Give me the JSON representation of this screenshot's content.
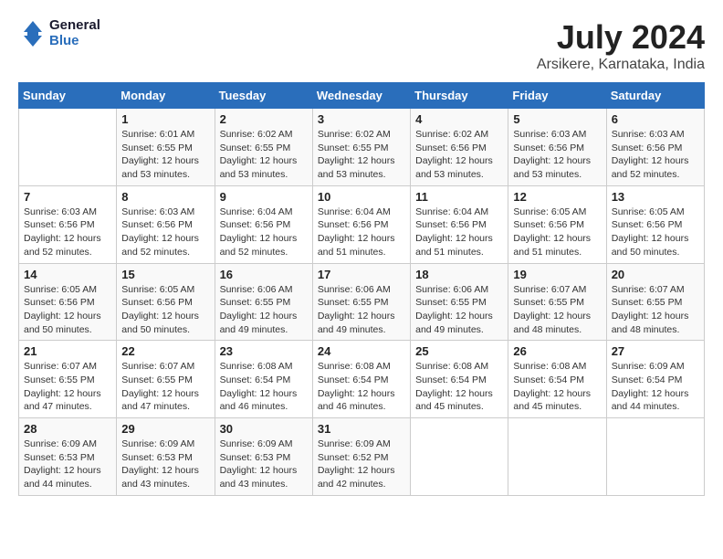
{
  "logo": {
    "text_general": "General",
    "text_blue": "Blue"
  },
  "header": {
    "month_year": "July 2024",
    "location": "Arsikere, Karnataka, India"
  },
  "days_of_week": [
    "Sunday",
    "Monday",
    "Tuesday",
    "Wednesday",
    "Thursday",
    "Friday",
    "Saturday"
  ],
  "weeks": [
    [
      {
        "day": "",
        "content": ""
      },
      {
        "day": "1",
        "content": "Sunrise: 6:01 AM\nSunset: 6:55 PM\nDaylight: 12 hours\nand 53 minutes."
      },
      {
        "day": "2",
        "content": "Sunrise: 6:02 AM\nSunset: 6:55 PM\nDaylight: 12 hours\nand 53 minutes."
      },
      {
        "day": "3",
        "content": "Sunrise: 6:02 AM\nSunset: 6:55 PM\nDaylight: 12 hours\nand 53 minutes."
      },
      {
        "day": "4",
        "content": "Sunrise: 6:02 AM\nSunset: 6:56 PM\nDaylight: 12 hours\nand 53 minutes."
      },
      {
        "day": "5",
        "content": "Sunrise: 6:03 AM\nSunset: 6:56 PM\nDaylight: 12 hours\nand 53 minutes."
      },
      {
        "day": "6",
        "content": "Sunrise: 6:03 AM\nSunset: 6:56 PM\nDaylight: 12 hours\nand 52 minutes."
      }
    ],
    [
      {
        "day": "7",
        "content": "Sunrise: 6:03 AM\nSunset: 6:56 PM\nDaylight: 12 hours\nand 52 minutes."
      },
      {
        "day": "8",
        "content": "Sunrise: 6:03 AM\nSunset: 6:56 PM\nDaylight: 12 hours\nand 52 minutes."
      },
      {
        "day": "9",
        "content": "Sunrise: 6:04 AM\nSunset: 6:56 PM\nDaylight: 12 hours\nand 52 minutes."
      },
      {
        "day": "10",
        "content": "Sunrise: 6:04 AM\nSunset: 6:56 PM\nDaylight: 12 hours\nand 51 minutes."
      },
      {
        "day": "11",
        "content": "Sunrise: 6:04 AM\nSunset: 6:56 PM\nDaylight: 12 hours\nand 51 minutes."
      },
      {
        "day": "12",
        "content": "Sunrise: 6:05 AM\nSunset: 6:56 PM\nDaylight: 12 hours\nand 51 minutes."
      },
      {
        "day": "13",
        "content": "Sunrise: 6:05 AM\nSunset: 6:56 PM\nDaylight: 12 hours\nand 50 minutes."
      }
    ],
    [
      {
        "day": "14",
        "content": "Sunrise: 6:05 AM\nSunset: 6:56 PM\nDaylight: 12 hours\nand 50 minutes."
      },
      {
        "day": "15",
        "content": "Sunrise: 6:05 AM\nSunset: 6:56 PM\nDaylight: 12 hours\nand 50 minutes."
      },
      {
        "day": "16",
        "content": "Sunrise: 6:06 AM\nSunset: 6:55 PM\nDaylight: 12 hours\nand 49 minutes."
      },
      {
        "day": "17",
        "content": "Sunrise: 6:06 AM\nSunset: 6:55 PM\nDaylight: 12 hours\nand 49 minutes."
      },
      {
        "day": "18",
        "content": "Sunrise: 6:06 AM\nSunset: 6:55 PM\nDaylight: 12 hours\nand 49 minutes."
      },
      {
        "day": "19",
        "content": "Sunrise: 6:07 AM\nSunset: 6:55 PM\nDaylight: 12 hours\nand 48 minutes."
      },
      {
        "day": "20",
        "content": "Sunrise: 6:07 AM\nSunset: 6:55 PM\nDaylight: 12 hours\nand 48 minutes."
      }
    ],
    [
      {
        "day": "21",
        "content": "Sunrise: 6:07 AM\nSunset: 6:55 PM\nDaylight: 12 hours\nand 47 minutes."
      },
      {
        "day": "22",
        "content": "Sunrise: 6:07 AM\nSunset: 6:55 PM\nDaylight: 12 hours\nand 47 minutes."
      },
      {
        "day": "23",
        "content": "Sunrise: 6:08 AM\nSunset: 6:54 PM\nDaylight: 12 hours\nand 46 minutes."
      },
      {
        "day": "24",
        "content": "Sunrise: 6:08 AM\nSunset: 6:54 PM\nDaylight: 12 hours\nand 46 minutes."
      },
      {
        "day": "25",
        "content": "Sunrise: 6:08 AM\nSunset: 6:54 PM\nDaylight: 12 hours\nand 45 minutes."
      },
      {
        "day": "26",
        "content": "Sunrise: 6:08 AM\nSunset: 6:54 PM\nDaylight: 12 hours\nand 45 minutes."
      },
      {
        "day": "27",
        "content": "Sunrise: 6:09 AM\nSunset: 6:54 PM\nDaylight: 12 hours\nand 44 minutes."
      }
    ],
    [
      {
        "day": "28",
        "content": "Sunrise: 6:09 AM\nSunset: 6:53 PM\nDaylight: 12 hours\nand 44 minutes."
      },
      {
        "day": "29",
        "content": "Sunrise: 6:09 AM\nSunset: 6:53 PM\nDaylight: 12 hours\nand 43 minutes."
      },
      {
        "day": "30",
        "content": "Sunrise: 6:09 AM\nSunset: 6:53 PM\nDaylight: 12 hours\nand 43 minutes."
      },
      {
        "day": "31",
        "content": "Sunrise: 6:09 AM\nSunset: 6:52 PM\nDaylight: 12 hours\nand 42 minutes."
      },
      {
        "day": "",
        "content": ""
      },
      {
        "day": "",
        "content": ""
      },
      {
        "day": "",
        "content": ""
      }
    ]
  ]
}
